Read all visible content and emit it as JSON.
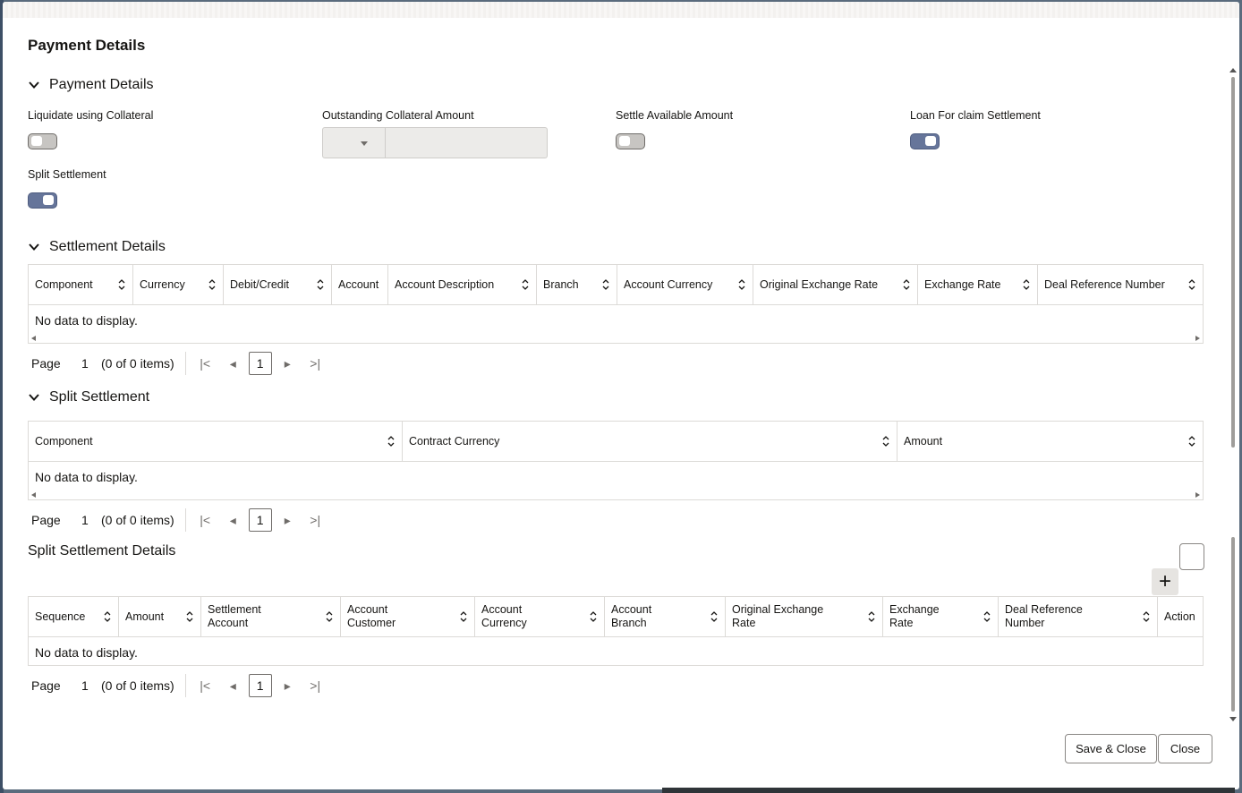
{
  "dialog": {
    "title": "Payment Details"
  },
  "payment_details": {
    "section_title": "Payment Details",
    "liquidate_using_collateral": {
      "label": "Liquidate using Collateral",
      "checked": false
    },
    "outstanding_collateral_amount": {
      "label": "Outstanding Collateral Amount",
      "currency": "",
      "amount": ""
    },
    "settle_available_amount": {
      "label": "Settle Available Amount",
      "checked": false
    },
    "loan_for_claim_settlement": {
      "label": "Loan For claim Settlement",
      "checked": true
    },
    "split_settlement": {
      "label": "Split Settlement",
      "checked": true
    }
  },
  "settlement_details": {
    "section_title": "Settlement Details",
    "columns": [
      "Component",
      "Currency",
      "Debit/Credit",
      "Account",
      "Account Description",
      "Branch",
      "Account Currency",
      "Original Exchange Rate",
      "Exchange Rate",
      "Deal Reference Number"
    ],
    "empty_text": "No data to display.",
    "pager": {
      "page_label": "Page",
      "page": "1",
      "items": "(0 of 0 items)",
      "current": "1"
    }
  },
  "split_settlement": {
    "section_title": "Split Settlement",
    "columns": [
      "Component",
      "Contract Currency",
      "Amount"
    ],
    "empty_text": "No data to display.",
    "pager": {
      "page_label": "Page",
      "page": "1",
      "items": "(0 of 0 items)",
      "current": "1"
    }
  },
  "split_settlement_details": {
    "section_title": "Split Settlement Details",
    "add_label": "+",
    "columns": [
      "Sequence",
      "Amount",
      "Settlement Account",
      "Account Customer",
      "Account Currency",
      "Account Branch",
      "Original Exchange Rate",
      "Exchange Rate",
      "Deal Reference Number",
      "Action"
    ],
    "empty_text": "No data to display.",
    "pager": {
      "page_label": "Page",
      "page": "1",
      "items": "(0 of 0 items)",
      "current": "1"
    }
  },
  "footer": {
    "save_close": "Save & Close",
    "close": "Close"
  }
}
